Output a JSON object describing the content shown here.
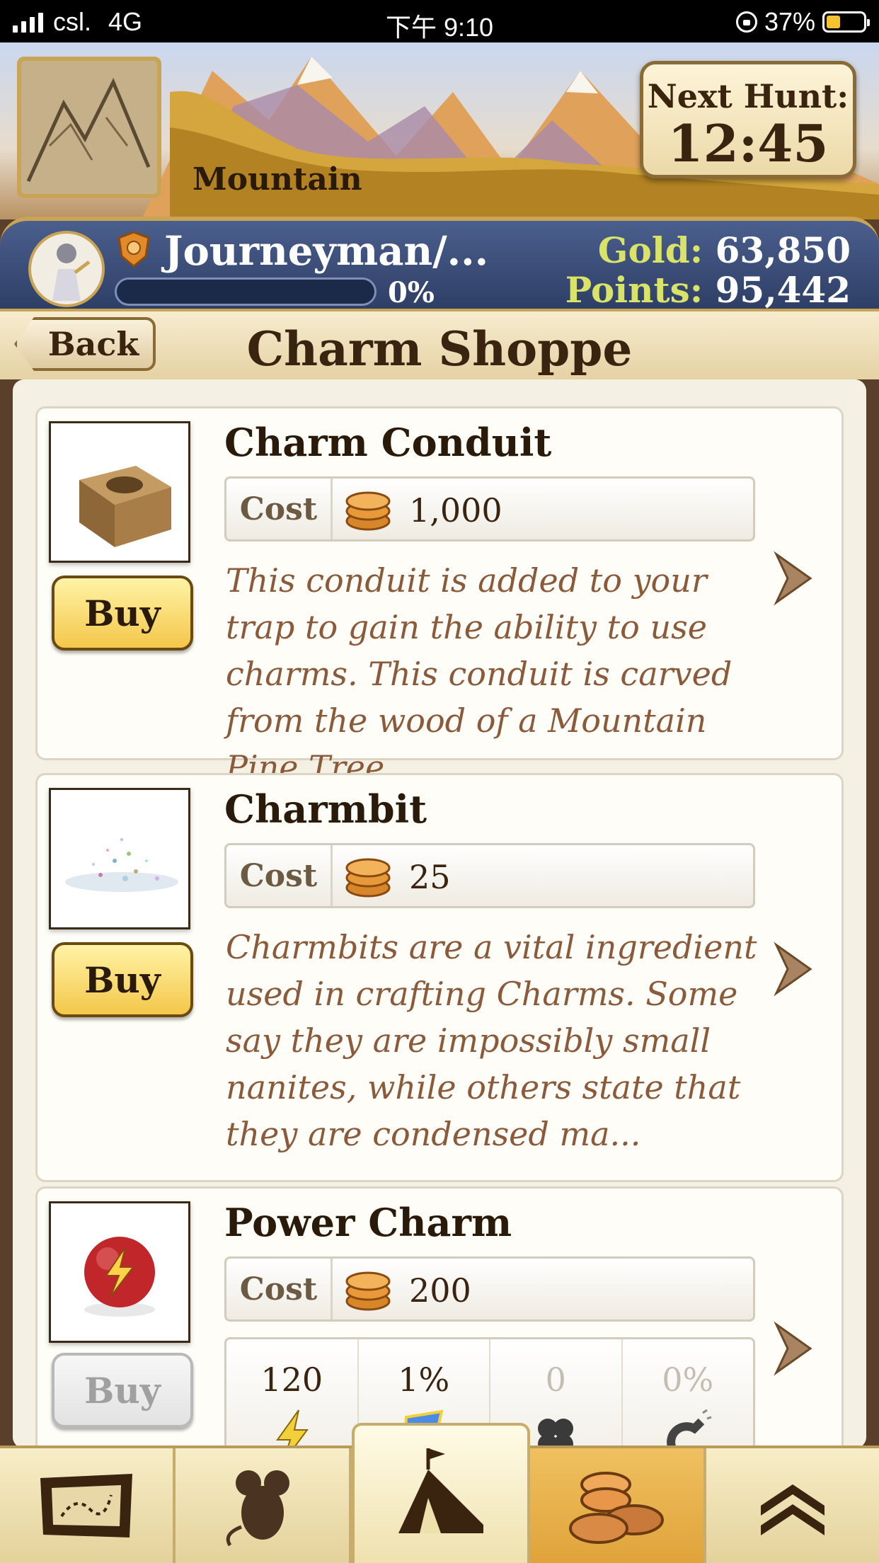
{
  "status_bar": {
    "carrier": "csl.",
    "network": "4G",
    "time": "下午 9:10",
    "battery": "37%",
    "battery_level": 0.37
  },
  "header": {
    "location": "Mountain",
    "next_hunt_label": "Next Hunt:",
    "next_hunt_time": "12:45"
  },
  "player": {
    "rank": "Journeyman/...",
    "progress_text": "0%",
    "progress": 0,
    "gold_label": "Gold:",
    "gold": "63,850",
    "points_label": "Points:",
    "points": "95,442"
  },
  "titlebar": {
    "back_label": "Back",
    "title": "Charm Shoppe"
  },
  "items": [
    {
      "name": "Charm Conduit",
      "cost_label": "Cost",
      "cost": "1,000",
      "buy_label": "Buy",
      "description": "This conduit is added to your trap to gain the ability to use charms. This conduit is carved from the wood of a Mountain Pine Tree."
    },
    {
      "name": "Charmbit",
      "cost_label": "Cost",
      "cost": "25",
      "buy_label": "Buy",
      "description": "Charmbits are a vital ingredient used in crafting Charms. Some say they are impossibly small nanites, while others state that they are condensed ma..."
    },
    {
      "name": "Power Charm",
      "cost_label": "Cost",
      "cost": "200",
      "buy_label": "Buy",
      "stats": [
        "120",
        "1%",
        "0",
        "0%"
      ]
    }
  ],
  "colors": {
    "accent_gold": "#c8a454",
    "player_bar": "#3a4f7c",
    "description_text": "#8a5a3a"
  },
  "nav": [
    "map-icon",
    "mouse-icon",
    "camp-icon",
    "coins-icon",
    "expand-icon"
  ]
}
